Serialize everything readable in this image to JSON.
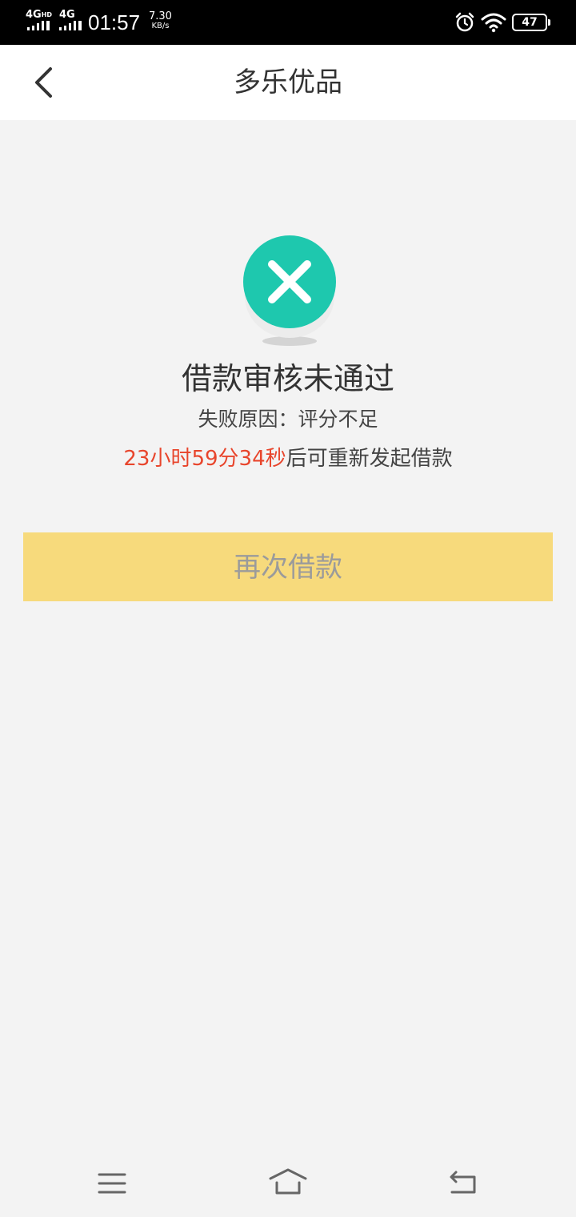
{
  "status_bar": {
    "network1": "4G",
    "network1_badge": "HD",
    "network2": "4G",
    "time": "01:57",
    "speed_value": "7.30",
    "speed_unit": "KB/s",
    "battery": "47",
    "icons": [
      "signal-icon",
      "alarm-icon",
      "wifi-icon",
      "battery-icon"
    ]
  },
  "header": {
    "title": "多乐优品",
    "back_icon": "chevron-left-icon"
  },
  "result": {
    "icon": "error-x-circle-icon",
    "icon_color": "#1ec8ae",
    "title": "借款审核未通过",
    "reason_label": "失败原因：",
    "reason": "评分不足",
    "countdown": "23小时59分34秒",
    "countdown_color": "#e8452c",
    "countdown_suffix": "后可重新发起借款"
  },
  "actions": {
    "retry_label": "再次借款",
    "retry_bg": "#f7da7c"
  },
  "system_nav": {
    "icons": [
      "menu-icon",
      "home-icon",
      "back-icon"
    ]
  }
}
